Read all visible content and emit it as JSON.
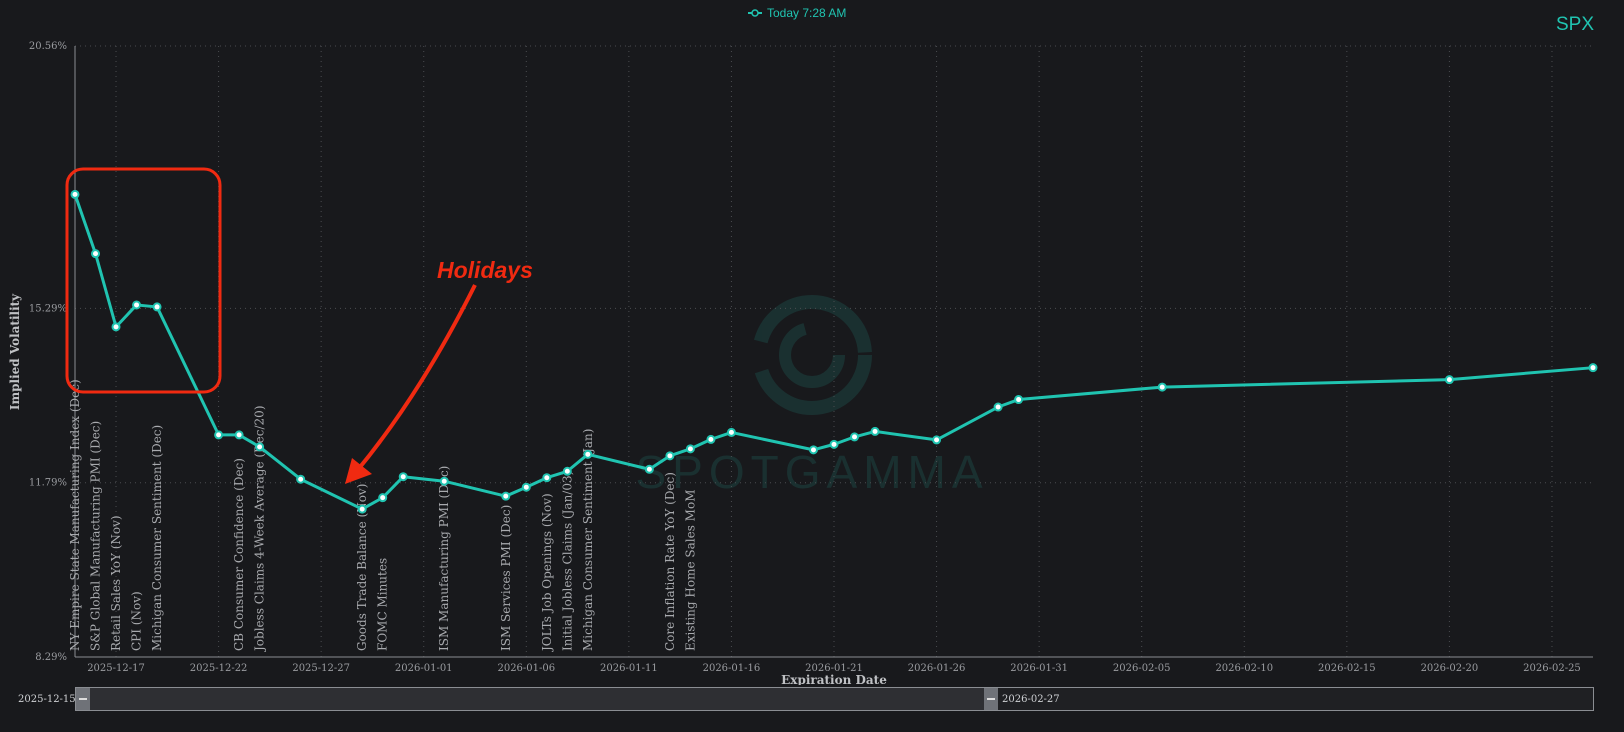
{
  "legend": {
    "label": "Today 7:28 AM"
  },
  "ticker": "SPX",
  "annotation": "Holidays",
  "range": {
    "start": "2025-12-15",
    "end": "2026-02-27"
  },
  "watermark": "SPOTGAMMA",
  "colors": {
    "line": "#20c4b1",
    "highlight": "#f02a11",
    "background": "#18191c"
  },
  "chart_data": {
    "type": "line",
    "xlabel": "Expiration Date",
    "ylabel": "Implied Volatility",
    "ylim": [
      8.29,
      20.56
    ],
    "yticks": [
      "8.29%",
      "11.79%",
      "15.29%",
      "20.56%"
    ],
    "xticks": [
      "2025-12-17",
      "2025-12-22",
      "2025-12-27",
      "2026-01-01",
      "2026-01-06",
      "2026-01-11",
      "2026-01-16",
      "2026-01-21",
      "2026-01-26",
      "2026-01-31",
      "2026-02-05",
      "2026-02-10",
      "2026-02-15",
      "2026-02-20",
      "2026-02-25"
    ],
    "series": [
      {
        "name": "Today 7:28 AM",
        "x": [
          "2025-12-15",
          "2025-12-16",
          "2025-12-17",
          "2025-12-18",
          "2025-12-19",
          "2025-12-22",
          "2025-12-23",
          "2025-12-24",
          "2025-12-26",
          "2025-12-29",
          "2025-12-30",
          "2025-12-31",
          "2026-01-02",
          "2026-01-05",
          "2026-01-06",
          "2026-01-07",
          "2026-01-08",
          "2026-01-09",
          "2026-01-12",
          "2026-01-13",
          "2026-01-14",
          "2026-01-15",
          "2026-01-16",
          "2026-01-20",
          "2026-01-21",
          "2026-01-22",
          "2026-01-23",
          "2026-01-26",
          "2026-01-29",
          "2026-01-30",
          "2026-02-06",
          "2026-02-20",
          "2026-02-27"
        ],
        "values": [
          17.58,
          16.39,
          14.92,
          15.36,
          15.32,
          12.75,
          12.75,
          12.51,
          11.86,
          11.26,
          11.49,
          11.91,
          11.82,
          11.52,
          11.7,
          11.89,
          12.02,
          12.36,
          12.06,
          12.33,
          12.47,
          12.66,
          12.8,
          12.45,
          12.56,
          12.71,
          12.82,
          12.65,
          13.31,
          13.46,
          13.71,
          13.86,
          14.1
        ]
      }
    ],
    "events": [
      {
        "date": "2025-12-15",
        "label": "NY Empire State Manufacturing Index (Dec)"
      },
      {
        "date": "2025-12-16",
        "label": "S&P Global Manufacturing PMI (Dec)"
      },
      {
        "date": "2025-12-17",
        "label": "Retail Sales YoY (Nov)"
      },
      {
        "date": "2025-12-18",
        "label": "CPI (Nov)"
      },
      {
        "date": "2025-12-19",
        "label": "Michigan Consumer Sentiment (Dec)"
      },
      {
        "date": "2025-12-23",
        "label": "CB Consumer Confidence (Dec)"
      },
      {
        "date": "2025-12-24",
        "label": "Jobless Claims 4-Week Average (Dec/20)"
      },
      {
        "date": "2025-12-29",
        "label": "Goods Trade Balance (Nov)"
      },
      {
        "date": "2025-12-30",
        "label": "FOMC Minutes"
      },
      {
        "date": "2026-01-02",
        "label": "ISM Manufacturing PMI (Dec)"
      },
      {
        "date": "2026-01-05",
        "label": "ISM Services PMI (Dec)"
      },
      {
        "date": "2026-01-07",
        "label": "JOLTs Job Openings (Nov)"
      },
      {
        "date": "2026-01-08",
        "label": "Initial Jobless Claims (Jan/03)"
      },
      {
        "date": "2026-01-09",
        "label": "Michigan Consumer Sentiment (Jan)"
      },
      {
        "date": "2026-01-13",
        "label": "Core Inflation Rate YoY (Dec)"
      },
      {
        "date": "2026-01-14",
        "label": "Existing Home Sales MoM"
      }
    ]
  }
}
